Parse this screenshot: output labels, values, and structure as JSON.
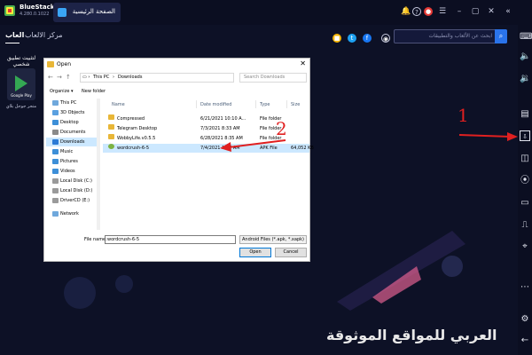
{
  "titlebar": {
    "app_name": "BlueStacks",
    "version": "4.280.0.1022",
    "home_tab": "الصفحة الرئيسية",
    "icons": [
      "bell-icon",
      "help-icon",
      "account-icon",
      "menu-icon",
      "minimize-icon",
      "maximize-icon",
      "close-icon",
      "expand-icon"
    ]
  },
  "nav": {
    "tab_top": "العاب",
    "tab_games": "مركز الالعاب",
    "search_placeholder": "ابحث عن الألعاب والتطبيقات"
  },
  "left_panel": {
    "heading": "لتثبيت تطبيق شخصي",
    "tile_text": "Google Play",
    "tile_caption": "متجر جوجل بلاي"
  },
  "dialog": {
    "title": "Open",
    "path": [
      "This PC",
      "Downloads"
    ],
    "search_placeholder": "Search Downloads",
    "organize": "Organize ▾",
    "new_folder": "New folder",
    "nav_items": [
      {
        "label": "This PC",
        "color": "#6fa8dc"
      },
      {
        "label": "3D Objects",
        "color": "#5aa0e0"
      },
      {
        "label": "Desktop",
        "color": "#3d8fd8"
      },
      {
        "label": "Documents",
        "color": "#8a8a8a"
      },
      {
        "label": "Downloads",
        "color": "#2b7bd6"
      },
      {
        "label": "Music",
        "color": "#3d8fd8"
      },
      {
        "label": "Pictures",
        "color": "#3d8fd8"
      },
      {
        "label": "Videos",
        "color": "#3d8fd8"
      },
      {
        "label": "Local Disk (C:)",
        "color": "#9a9a9a"
      },
      {
        "label": "Local Disk (D:)",
        "color": "#9a9a9a"
      },
      {
        "label": "DriverCD (E:)",
        "color": "#9a9a9a"
      },
      {
        "label": "Network",
        "color": "#6fa8dc"
      }
    ],
    "columns": [
      "Name",
      "Date modified",
      "Type",
      "Size"
    ],
    "files": [
      {
        "name": "Compressed",
        "date": "6/21/2021 10:10 A...",
        "type": "File folder",
        "size": ""
      },
      {
        "name": "Telegram Desktop",
        "date": "7/3/2021 8:33 AM",
        "type": "File folder",
        "size": ""
      },
      {
        "name": "WobbyLife.v0.5.5",
        "date": "6/28/2021 8:35 AM",
        "type": "File folder",
        "size": ""
      },
      {
        "name": "wordcrush-6-5",
        "date": "7/4/2021 1:07 AM",
        "type": "APK File",
        "size": "64,052 KB"
      }
    ],
    "file_name_label": "File name:",
    "file_name_value": "wordcrush-6-5",
    "file_type": "Android Files (*.apk, *.xapk)",
    "open_label": "Open",
    "cancel_label": "Cancel"
  },
  "annotations": {
    "num1": "1",
    "num2": "2",
    "watermark": "العربي للمواقع الموثوقة",
    "arrow_color": "#e02020"
  },
  "sidebar_icons": [
    "keyboard-icon",
    "volume-icon",
    "volume-low-icon",
    "layers-icon",
    "install-apk-icon",
    "screenshot-icon",
    "record-icon",
    "folder-icon",
    "shake-icon",
    "location-icon",
    "dots-icon",
    "settings-icon",
    "back-icon"
  ]
}
